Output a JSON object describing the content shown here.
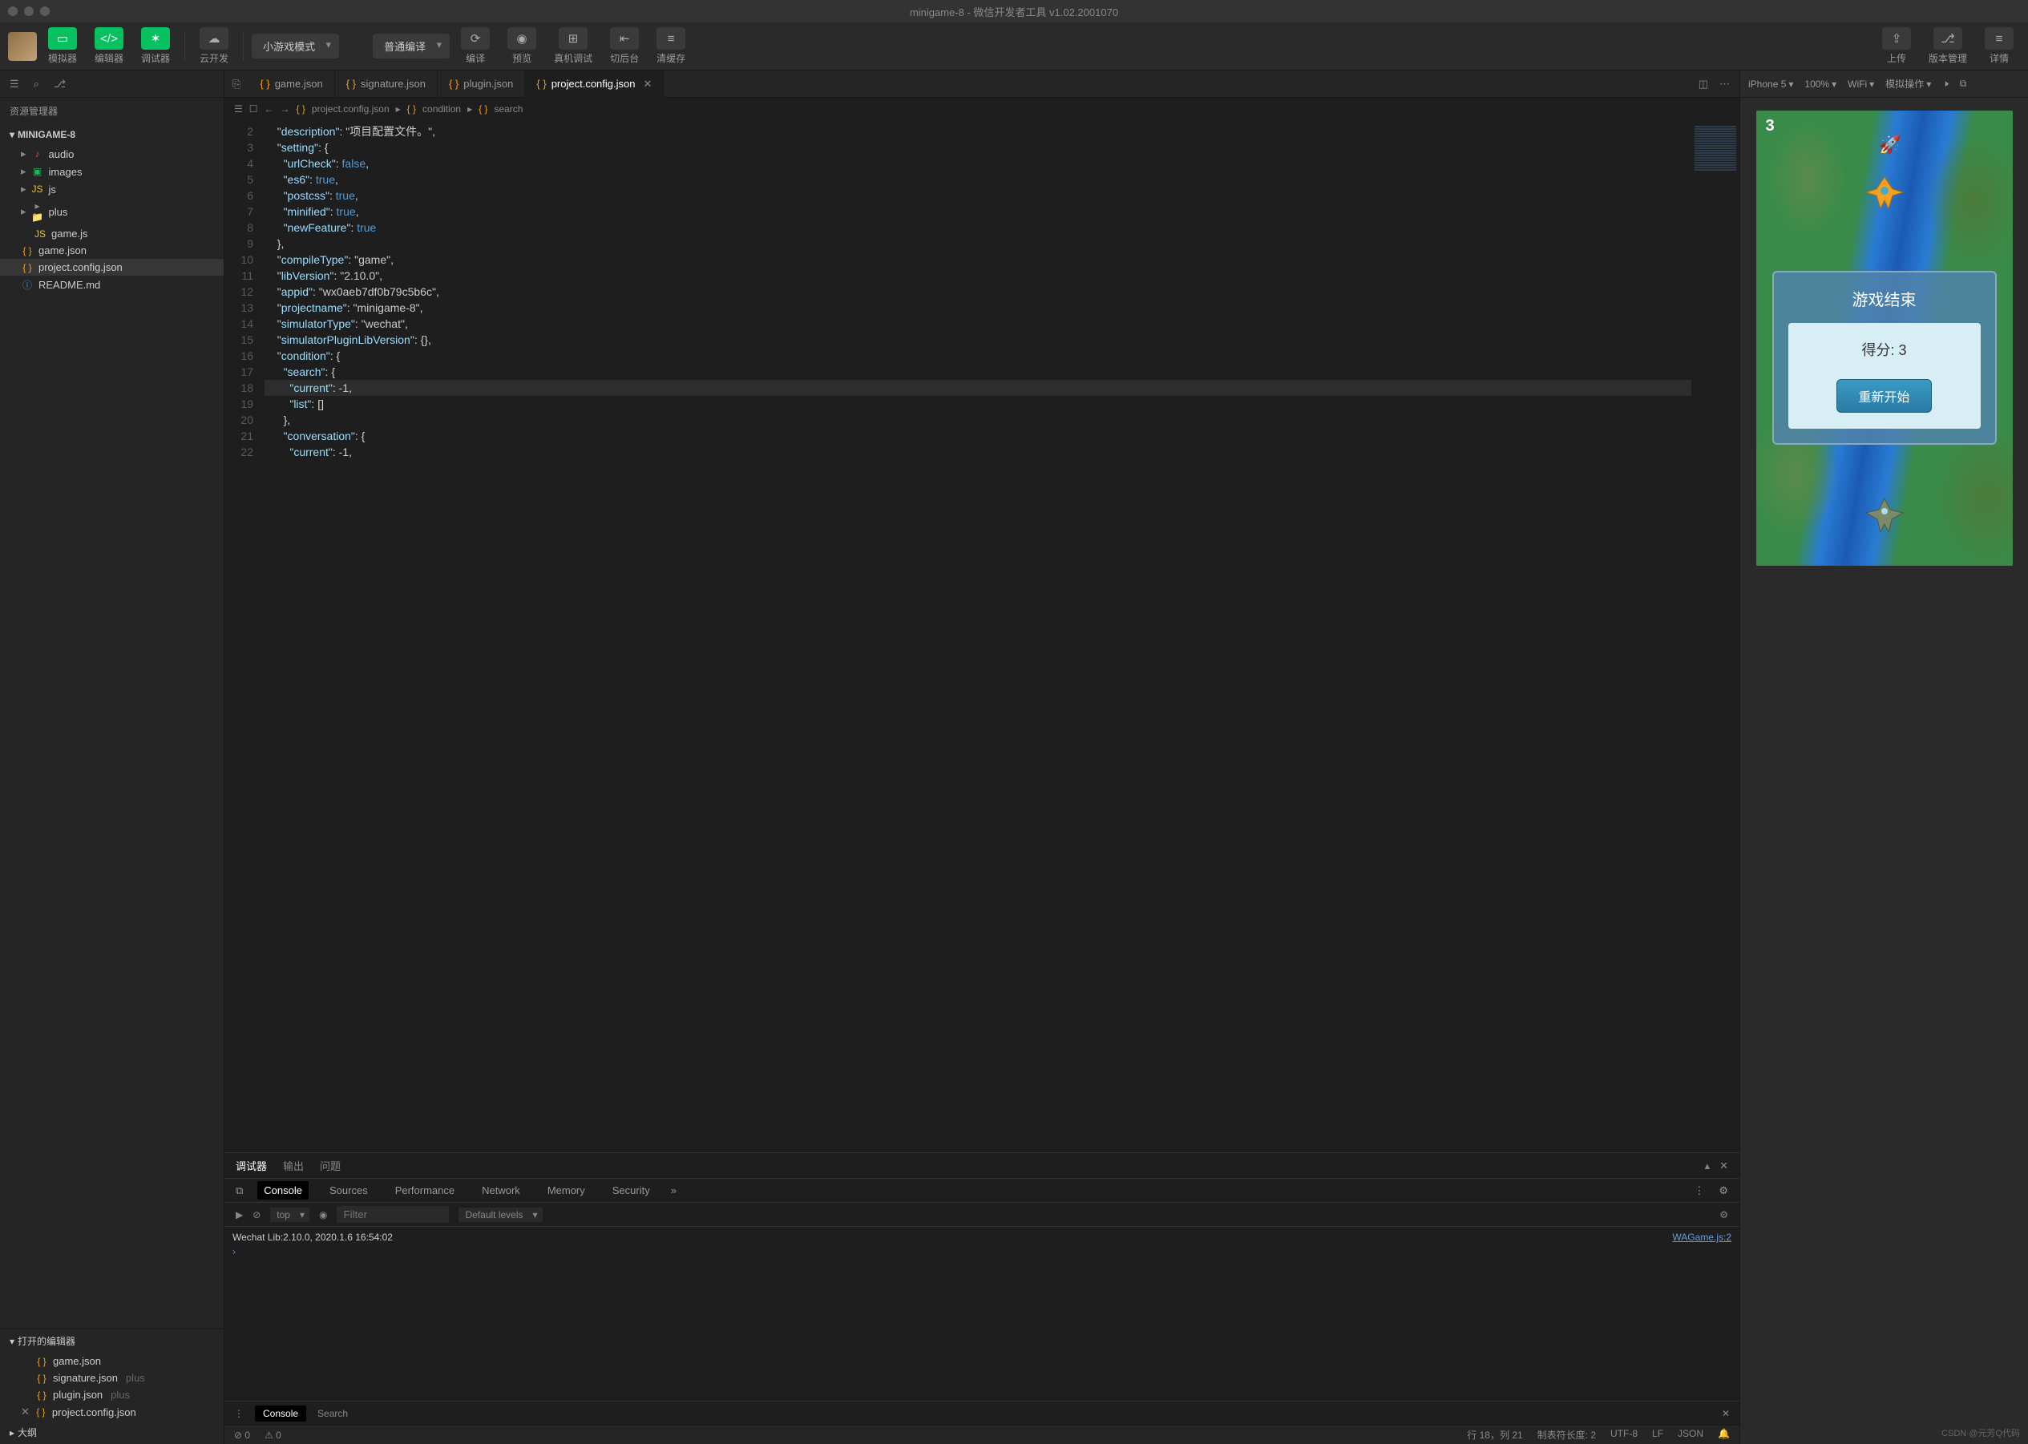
{
  "title": "minigame-8 - 微信开发者工具 v1.02.2001070",
  "toolbar": {
    "simulator": "模拟器",
    "editor": "编辑器",
    "debugger": "调试器",
    "cloud": "云开发",
    "mode": "小游戏模式",
    "compile_mode": "普通编译",
    "compile": "编译",
    "preview": "预览",
    "real": "真机调试",
    "background": "切后台",
    "cache": "清缓存",
    "upload": "上传",
    "version": "版本管理",
    "detail": "详情"
  },
  "sidebar": {
    "title": "资源管理器",
    "project": "MINIGAME-8",
    "items": [
      {
        "icon": "audio",
        "label": "audio",
        "type": "folder",
        "depth": 1
      },
      {
        "icon": "img",
        "label": "images",
        "type": "folder",
        "depth": 1
      },
      {
        "icon": "js",
        "label": "js",
        "type": "folder",
        "depth": 1
      },
      {
        "icon": "folder",
        "label": "plus",
        "type": "folder",
        "depth": 1
      },
      {
        "icon": "js",
        "label": "game.js",
        "type": "file",
        "depth": 2
      },
      {
        "icon": "json",
        "label": "game.json",
        "type": "file",
        "depth": 1
      },
      {
        "icon": "json",
        "label": "project.config.json",
        "type": "file",
        "depth": 1,
        "sel": true
      },
      {
        "icon": "md",
        "label": "README.md",
        "type": "file",
        "depth": 1
      }
    ],
    "open_title": "打开的编辑器",
    "open": [
      {
        "icon": "json",
        "label": "game.json",
        "suffix": ""
      },
      {
        "icon": "json",
        "label": "signature.json",
        "suffix": "plus"
      },
      {
        "icon": "json",
        "label": "plugin.json",
        "suffix": "plus"
      },
      {
        "icon": "json",
        "label": "project.config.json",
        "suffix": "",
        "close": true
      }
    ],
    "outline": "大纲"
  },
  "tabs": [
    {
      "label": "game.json"
    },
    {
      "label": "signature.json"
    },
    {
      "label": "plugin.json"
    },
    {
      "label": "project.config.json",
      "active": true
    }
  ],
  "breadcrumb": [
    "project.config.json",
    "condition",
    "search"
  ],
  "code": {
    "start": 2,
    "lines": [
      {
        "t": "  \"description\": \"项目配置文件。\","
      },
      {
        "t": "  \"setting\": {"
      },
      {
        "t": "    \"urlCheck\": false,"
      },
      {
        "t": "    \"es6\": true,"
      },
      {
        "t": "    \"postcss\": true,"
      },
      {
        "t": "    \"minified\": true,"
      },
      {
        "t": "    \"newFeature\": true"
      },
      {
        "t": "  },"
      },
      {
        "t": "  \"compileType\": \"game\","
      },
      {
        "t": "  \"libVersion\": \"2.10.0\","
      },
      {
        "t": "  \"appid\": \"wx0aeb7df0b79c5b6c\","
      },
      {
        "t": "  \"projectname\": \"minigame-8\","
      },
      {
        "t": "  \"simulatorType\": \"wechat\","
      },
      {
        "t": "  \"simulatorPluginLibVersion\": {},"
      },
      {
        "t": "  \"condition\": {"
      },
      {
        "t": "    \"search\": {"
      },
      {
        "t": "      \"current\": -1,",
        "hl": true
      },
      {
        "t": "      \"list\": []"
      },
      {
        "t": "    },"
      },
      {
        "t": "    \"conversation\": {"
      },
      {
        "t": "      \"current\": -1,"
      }
    ]
  },
  "panel": {
    "tabs": [
      "调试器",
      "输出",
      "问题"
    ],
    "dev": [
      "Console",
      "Sources",
      "Performance",
      "Network",
      "Memory",
      "Security"
    ],
    "top": "top",
    "filter_ph": "Filter",
    "levels": "Default levels",
    "log": "Wechat Lib:2.10.0, 2020.1.6 16:54:02",
    "src": "WAGame.js:2",
    "foot_console": "Console",
    "foot_search": "Search"
  },
  "status": {
    "errors": "⊘ 0",
    "warnings": "⚠ 0",
    "pos": "行 18，列 21",
    "tab": "制表符长度: 2",
    "enc": "UTF-8",
    "eol": "LF",
    "lang": "JSON"
  },
  "right": {
    "device": "iPhone 5",
    "zoom": "100%",
    "net": "WiFi",
    "action": "模拟操作"
  },
  "game": {
    "score": "3",
    "over": "游戏结束",
    "score_label": "得分: 3",
    "restart": "重新开始"
  },
  "watermark": "CSDN @元芳Q代码"
}
